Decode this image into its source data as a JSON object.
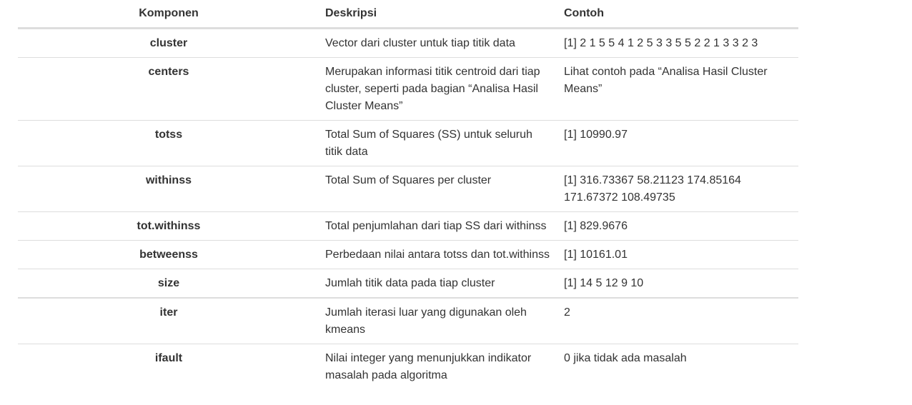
{
  "table": {
    "headers": [
      "Komponen",
      "Deskripsi",
      "Contoh"
    ],
    "rows": [
      {
        "komponen": "cluster",
        "deskripsi": "Vector dari cluster untuk tiap titik data",
        "contoh": "[1] 2 1 5 5 4 1 2 5 3 3 5 5 2 2 1 3 3 2 3"
      },
      {
        "komponen": "centers",
        "deskripsi": "Merupakan informasi titik centroid dari tiap cluster, seperti pada bagian “Analisa Hasil Cluster Means”",
        "contoh": "Lihat contoh pada “Analisa Hasil Cluster Means”"
      },
      {
        "komponen": "totss",
        "deskripsi": "Total Sum of Squares (SS) untuk seluruh titik data",
        "contoh": "[1] 10990.97"
      },
      {
        "komponen": "withinss",
        "deskripsi": "Total Sum of Squares per cluster",
        "contoh": "[1] 316.73367 58.21123 174.85164 171.67372 108.49735"
      },
      {
        "komponen": "tot.withinss",
        "deskripsi": "Total penjumlahan dari tiap SS dari withinss",
        "contoh": "[1] 829.9676"
      },
      {
        "komponen": "betweenss",
        "deskripsi": "Perbedaan nilai antara totss dan tot.withinss",
        "contoh": "[1] 10161.01"
      },
      {
        "komponen": "size",
        "deskripsi": "Jumlah titik data pada tiap cluster",
        "contoh": "[1] 14 5 12 9 10"
      },
      {
        "komponen": "iter",
        "deskripsi": "Jumlah iterasi luar yang digunakan oleh kmeans",
        "contoh": "2"
      },
      {
        "komponen": "ifault",
        "deskripsi": "Nilai integer yang menunjukkan indikator masalah pada algoritma",
        "contoh": "0 jika tidak ada masalah"
      }
    ]
  }
}
